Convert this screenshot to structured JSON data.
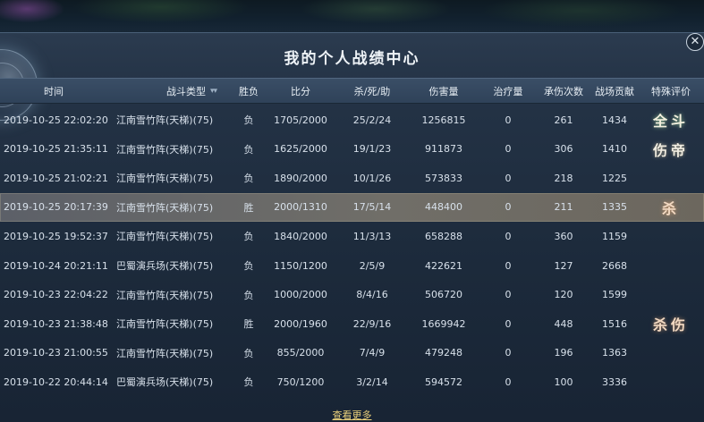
{
  "title": "我的个人战绩中心",
  "headers": {
    "time": "时间",
    "type": "战斗类型",
    "result": "胜负",
    "score": "比分",
    "kda": "杀/死/助",
    "damage": "伤害量",
    "heal": "治疗量",
    "taken": "承伤次数",
    "contrib": "战场贡献",
    "eval": "特殊评价"
  },
  "rows": [
    {
      "time": "2019-10-25 22:02:20",
      "type": "江南雪竹阵(天梯)(75)",
      "result": "负",
      "score": "1705/2000",
      "kda": "25/2/24",
      "damage": "1256815",
      "heal": "0",
      "taken": "261",
      "contrib": "1434",
      "eval": "全斗"
    },
    {
      "time": "2019-10-25 21:35:11",
      "type": "江南雪竹阵(天梯)(75)",
      "result": "负",
      "score": "1625/2000",
      "kda": "19/1/23",
      "damage": "911873",
      "heal": "0",
      "taken": "306",
      "contrib": "1410",
      "eval": "伤帝"
    },
    {
      "time": "2019-10-25 21:02:21",
      "type": "江南雪竹阵(天梯)(75)",
      "result": "负",
      "score": "1890/2000",
      "kda": "10/1/26",
      "damage": "573833",
      "heal": "0",
      "taken": "218",
      "contrib": "1225",
      "eval": ""
    },
    {
      "time": "2019-10-25 20:17:39",
      "type": "江南雪竹阵(天梯)(75)",
      "result": "胜",
      "score": "2000/1310",
      "kda": "17/5/14",
      "damage": "448400",
      "heal": "0",
      "taken": "211",
      "contrib": "1335",
      "eval": "杀"
    },
    {
      "time": "2019-10-25 19:52:37",
      "type": "江南雪竹阵(天梯)(75)",
      "result": "负",
      "score": "1840/2000",
      "kda": "11/3/13",
      "damage": "658288",
      "heal": "0",
      "taken": "360",
      "contrib": "1159",
      "eval": ""
    },
    {
      "time": "2019-10-24 20:21:11",
      "type": "巴蜀演兵场(天梯)(75)",
      "result": "负",
      "score": "1150/1200",
      "kda": "2/5/9",
      "damage": "422621",
      "heal": "0",
      "taken": "127",
      "contrib": "2668",
      "eval": ""
    },
    {
      "time": "2019-10-23 22:04:22",
      "type": "江南雪竹阵(天梯)(75)",
      "result": "负",
      "score": "1000/2000",
      "kda": "8/4/16",
      "damage": "506720",
      "heal": "0",
      "taken": "120",
      "contrib": "1599",
      "eval": ""
    },
    {
      "time": "2019-10-23 21:38:48",
      "type": "江南雪竹阵(天梯)(75)",
      "result": "胜",
      "score": "2000/1960",
      "kda": "22/9/16",
      "damage": "1669942",
      "heal": "0",
      "taken": "448",
      "contrib": "1516",
      "eval": "杀伤"
    },
    {
      "time": "2019-10-23 21:00:55",
      "type": "江南雪竹阵(天梯)(75)",
      "result": "负",
      "score": "855/2000",
      "kda": "7/4/9",
      "damage": "479248",
      "heal": "0",
      "taken": "196",
      "contrib": "1363",
      "eval": ""
    },
    {
      "time": "2019-10-22 20:44:14",
      "type": "巴蜀演兵场(天梯)(75)",
      "result": "负",
      "score": "750/1200",
      "kda": "3/2/14",
      "damage": "594572",
      "heal": "0",
      "taken": "100",
      "contrib": "3336",
      "eval": ""
    }
  ],
  "selected_row": 3,
  "more_label": "查看更多",
  "close_glyph": "✕",
  "sort_glyph": "▾▾",
  "icons": {
    "close": "close-icon",
    "sort": "sort-icon"
  },
  "colors": {
    "accent": "#e8cf7a",
    "panel": "#1c2a3b",
    "selected": "#6c675e"
  }
}
